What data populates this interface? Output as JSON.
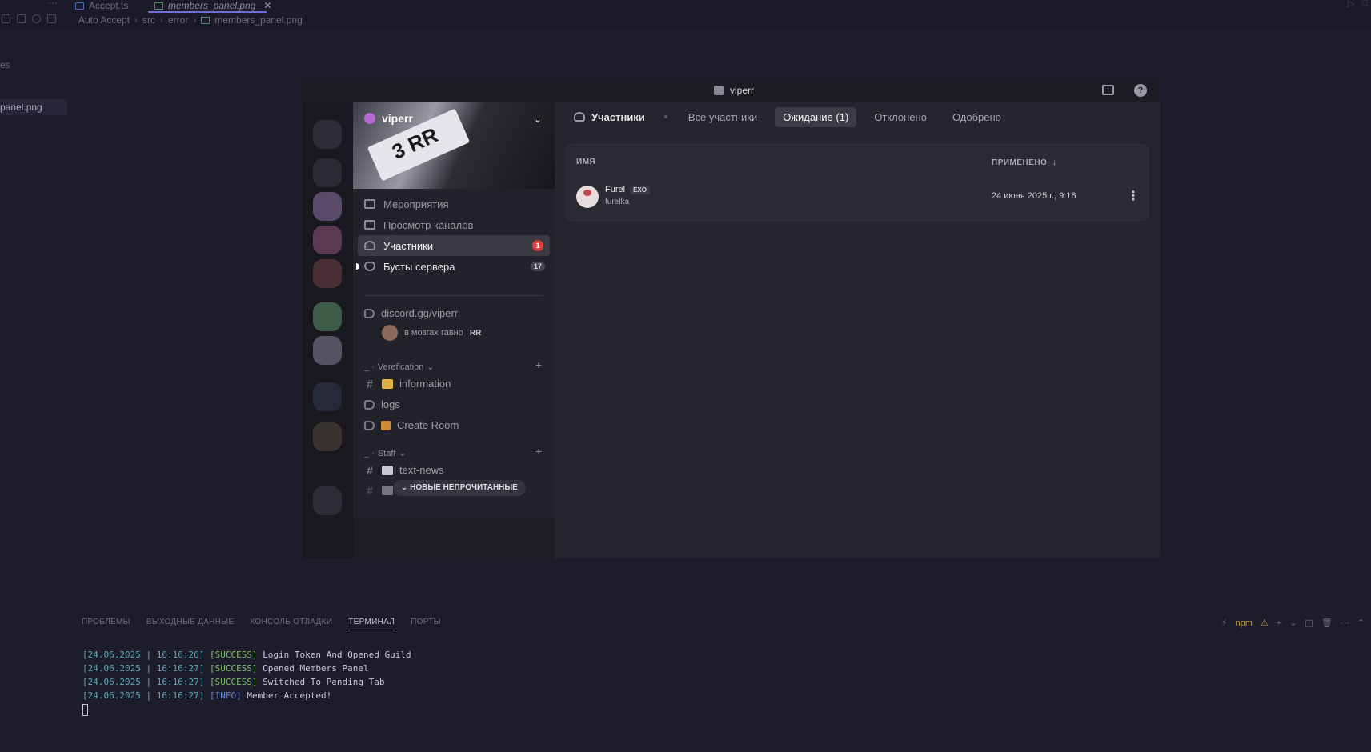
{
  "editor": {
    "tabs": [
      {
        "label": "Accept.ts",
        "active": false
      },
      {
        "label": "members_panel.png",
        "active": true
      }
    ],
    "breadcrumbs": [
      "Auto Accept",
      "src",
      "error",
      "members_panel.png"
    ],
    "explorer_fragment": "es",
    "explorer_selected_file": "panel.png"
  },
  "discord": {
    "window_title": "viperr",
    "server": {
      "name": "viperr",
      "banner_text": "3 RR"
    },
    "nav": [
      {
        "label": "Мероприятия"
      },
      {
        "label": "Просмотр каналов"
      },
      {
        "label": "Участники",
        "badge": "1"
      },
      {
        "label": "Бусты сервера",
        "badge": "17"
      }
    ],
    "invite_channel": "discord.gg/viperr",
    "voice_user": {
      "text": "в мозгах гавно",
      "tag": "RR"
    },
    "categories": [
      {
        "name": "Verefication",
        "channels": [
          "information",
          "logs",
          "Create Room"
        ]
      },
      {
        "name": "Staff",
        "channels": [
          "text-news"
        ]
      }
    ],
    "new_unread": "НОВЫЕ НЕПРОЧИТАННЫЕ",
    "members": {
      "title": "Участники",
      "tabs": [
        "Все участники",
        "Ожидание (1)",
        "Отклонено",
        "Одобрено"
      ],
      "selected_tab": "Ожидание (1)",
      "columns": [
        "ИМЯ",
        "ПРИМЕНЕНО"
      ],
      "rows": [
        {
          "name": "Furel",
          "tag": "EXO",
          "handle": "furelka",
          "applied": "24 июня 2025 г., 9:16"
        }
      ]
    }
  },
  "panel": {
    "tabs": [
      "ПРОБЛЕМЫ",
      "ВЫХОДНЫЕ ДАННЫЕ",
      "КОНСОЛЬ ОТЛАДКИ",
      "ТЕРМИНАЛ",
      "ПОРТЫ"
    ],
    "active_tab": "ТЕРМИНАЛ",
    "npm_label": "npm",
    "terminal_lines": [
      {
        "ts": "[24.06.2025 | 16:16:26]",
        "level": "[SUCCESS]",
        "msg": "Login Token And Opened Guild"
      },
      {
        "ts": "[24.06.2025 | 16:16:27]",
        "level": "[SUCCESS]",
        "msg": "Opened Members Panel"
      },
      {
        "ts": "[24.06.2025 | 16:16:27]",
        "level": "[SUCCESS]",
        "msg": "Switched To Pending Tab"
      },
      {
        "ts": "[24.06.2025 | 16:16:27]",
        "level": "[INFO]",
        "msg": "Member Accepted!"
      }
    ]
  },
  "colors": {
    "accent": "#6f6fd8",
    "success": "#7fbf6a",
    "info": "#5e86d6",
    "timestamp": "#5aa9b8",
    "badge_red": "#d83c3e"
  }
}
